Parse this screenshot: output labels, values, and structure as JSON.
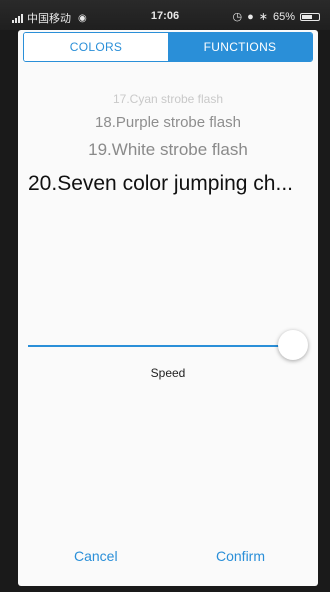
{
  "status_bar": {
    "carrier": "中国移动",
    "time": "17:06",
    "battery": "65%",
    "battery_level": 0.65
  },
  "tabs": {
    "colors": "COLORS",
    "functions": "FUNCTIONS",
    "active": "functions"
  },
  "picker": {
    "items": [
      "17.Cyan strobe flash",
      "18.Purple strobe flash",
      "19.White strobe flash",
      "20.Seven color jumping ch..."
    ],
    "selected_index": 3
  },
  "speed": {
    "label": "Speed",
    "value_fraction": 0.98
  },
  "buttons": {
    "cancel": "Cancel",
    "confirm": "Confirm"
  },
  "colors": {
    "accent": "#2a8fd8"
  }
}
